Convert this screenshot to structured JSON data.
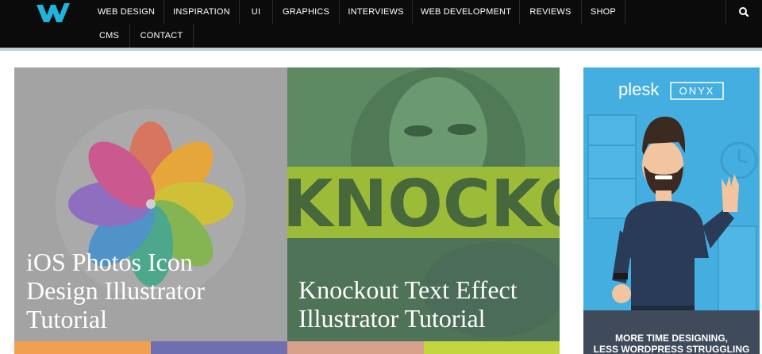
{
  "nav": {
    "items": [
      {
        "label": "WEB DESIGN"
      },
      {
        "label": "INSPIRATION"
      },
      {
        "label": "UI"
      },
      {
        "label": "GRAPHICS"
      },
      {
        "label": "INTERVIEWS"
      },
      {
        "label": "WEB DEVELOPMENT"
      },
      {
        "label": "REVIEWS"
      },
      {
        "label": "SHOP"
      },
      {
        "label": "CMS"
      },
      {
        "label": "CONTACT"
      }
    ],
    "search_icon": "search-icon",
    "logo_icon": "w-logo-icon",
    "accent": "#1fb4dc"
  },
  "featured": [
    {
      "title_lines": [
        "iOS Photos Icon",
        "Design Illustrator",
        "Tutorial"
      ]
    },
    {
      "title_lines": [
        "Knockout Text Effect",
        "Illustrator Tutorial"
      ],
      "image_text": "KNOCKOUT"
    }
  ],
  "ad": {
    "brand_left": "plesk",
    "brand_right": "ONYX",
    "tagline_lines": [
      "MORE TIME DESIGNING,",
      "LESS WORDPRESS STRUGGLING"
    ],
    "color": "#45aee0"
  }
}
